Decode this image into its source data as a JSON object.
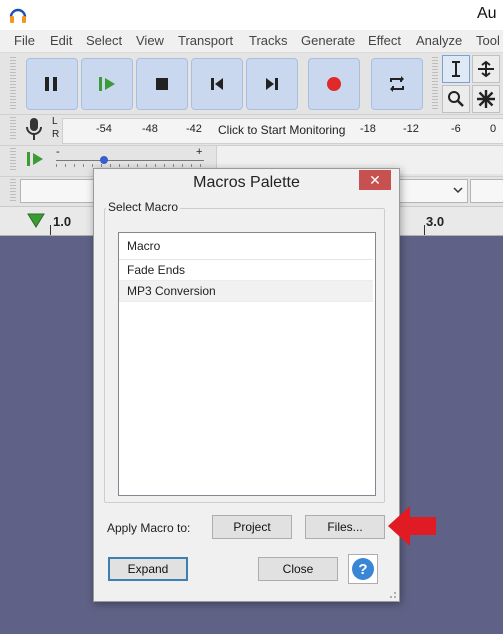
{
  "window": {
    "title_visible": "Au",
    "icon": "audacity-headphones-icon"
  },
  "menu": [
    "File",
    "Edit",
    "Select",
    "View",
    "Transport",
    "Tracks",
    "Generate",
    "Effect",
    "Analyze",
    "Tool"
  ],
  "transport": {
    "buttons": [
      "pause",
      "play",
      "stop",
      "skip-to-start",
      "skip-to-end",
      "record",
      "loop"
    ]
  },
  "tools": [
    "selection-tool",
    "envelope-tool",
    "zoom-tool",
    "multi-tool"
  ],
  "meter": {
    "channels": [
      "L",
      "R"
    ],
    "ticks_left": [
      "-54",
      "-48",
      "-42"
    ],
    "monitor_text": "Click to Start Monitoring",
    "ticks_right": [
      "-18",
      "-12",
      "-6",
      "0"
    ]
  },
  "play_speed": {
    "min": "-",
    "max": "+"
  },
  "timeline": {
    "labels": [
      "1.0",
      "3.0"
    ]
  },
  "dialog": {
    "title": "Macros Palette",
    "close": "✕",
    "group_label": "Select Macro",
    "column_header": "Macro",
    "macros": [
      "Fade Ends",
      "MP3 Conversion"
    ],
    "selected_index": 1,
    "apply_label": "Apply Macro to:",
    "project_button": "Project",
    "files_button": "Files...",
    "expand_button": "Expand",
    "close_button": "Close",
    "help_button": "?"
  },
  "colors": {
    "background": "#5f6286",
    "transport_button": "#c9d8ef",
    "record": "#e02a2a",
    "close_button": "#c75050",
    "annotation_arrow": "#e01b24"
  }
}
